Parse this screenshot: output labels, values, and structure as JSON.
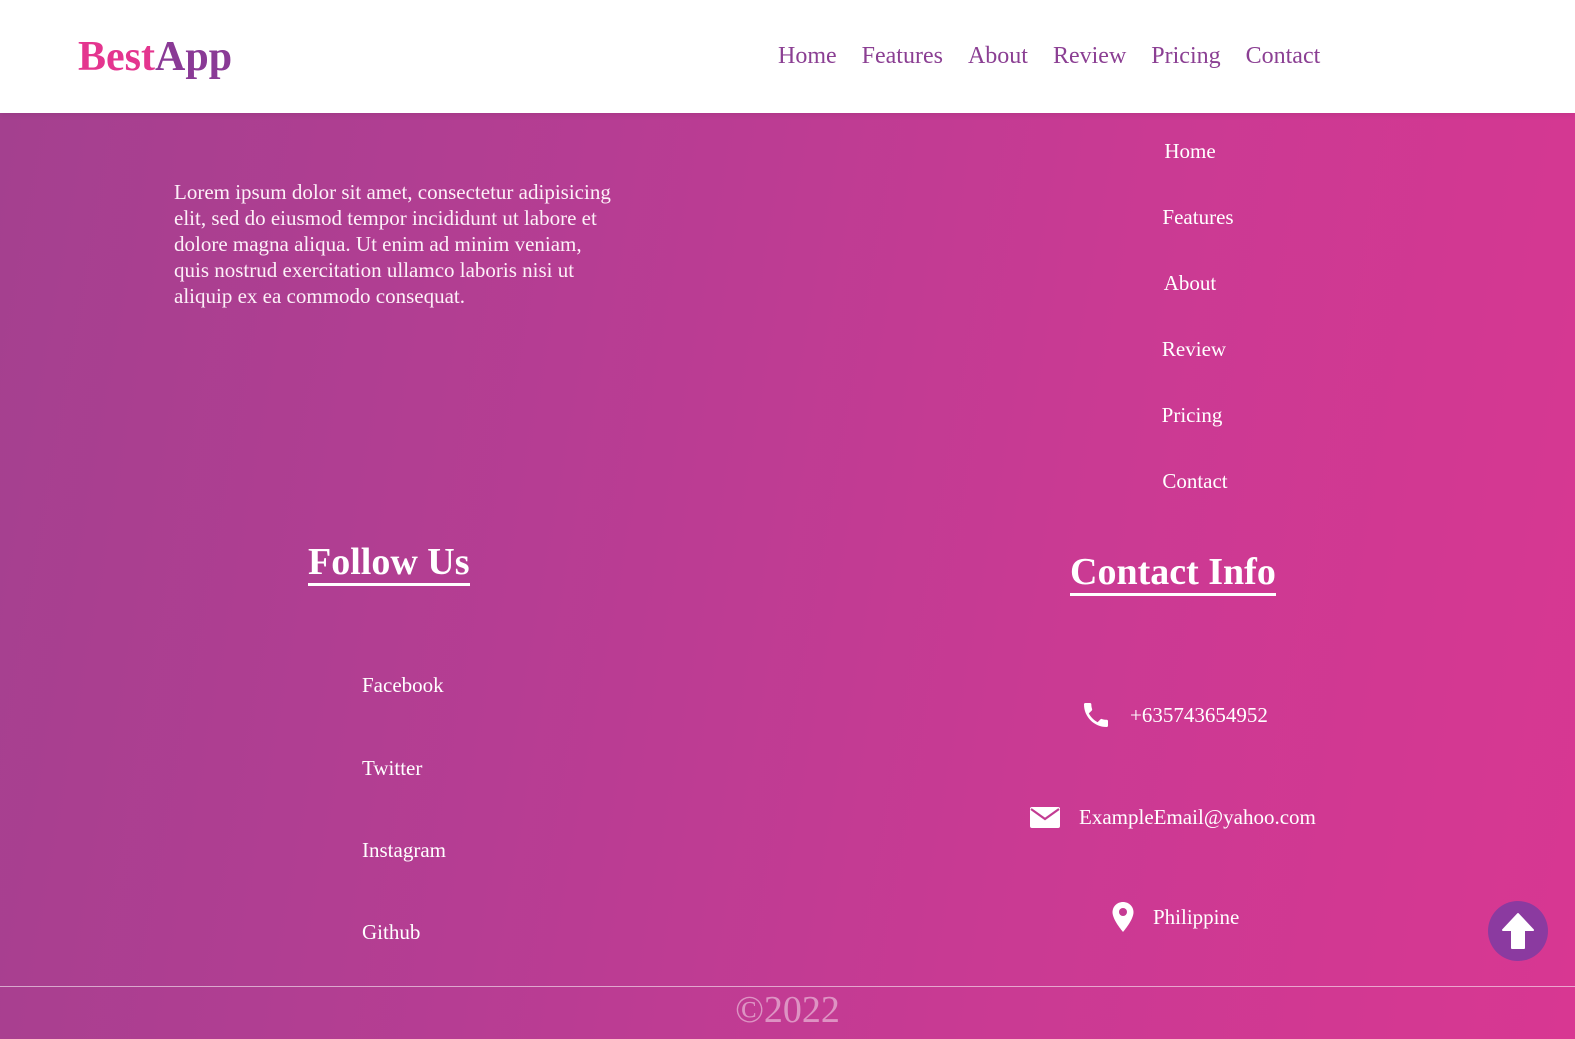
{
  "header": {
    "logo_part1": "Best",
    "logo_part2": "App",
    "nav": [
      "Home",
      "Features",
      "About",
      "Review",
      "Pricing",
      "Contact"
    ]
  },
  "footer": {
    "about_text": "Lorem ipsum dolor sit amet, consectetur adipisicing elit, sed do eiusmod tempor incididunt ut labore et dolore magna aliqua. Ut enim ad minim veniam, quis nostrud exercitation ullamco laboris nisi ut aliquip ex ea commodo consequat.",
    "links": [
      "Home",
      "Features",
      "About",
      "Review",
      "Pricing",
      "Contact"
    ],
    "follow_title": "Follow Us",
    "social": [
      "Facebook",
      "Twitter",
      "Instagram",
      "Github"
    ],
    "contact_title": "Contact Info",
    "contact": {
      "phone": "+635743654952",
      "email": "ExampleEmail@yahoo.com",
      "location": "Philippine"
    },
    "copyright": "©2022"
  },
  "icons": {
    "phone": "phone-icon",
    "email": "envelope-icon",
    "location": "map-pin-icon",
    "scroll_top": "arrow-up-icon"
  },
  "colors": {
    "logo_pink": "#e4358f",
    "logo_purple": "#8a3a96",
    "nav_text": "#8b3f93",
    "gradient_start": "#a4408f",
    "gradient_end": "#d83792",
    "scroll_button": "#8b3aa0"
  }
}
